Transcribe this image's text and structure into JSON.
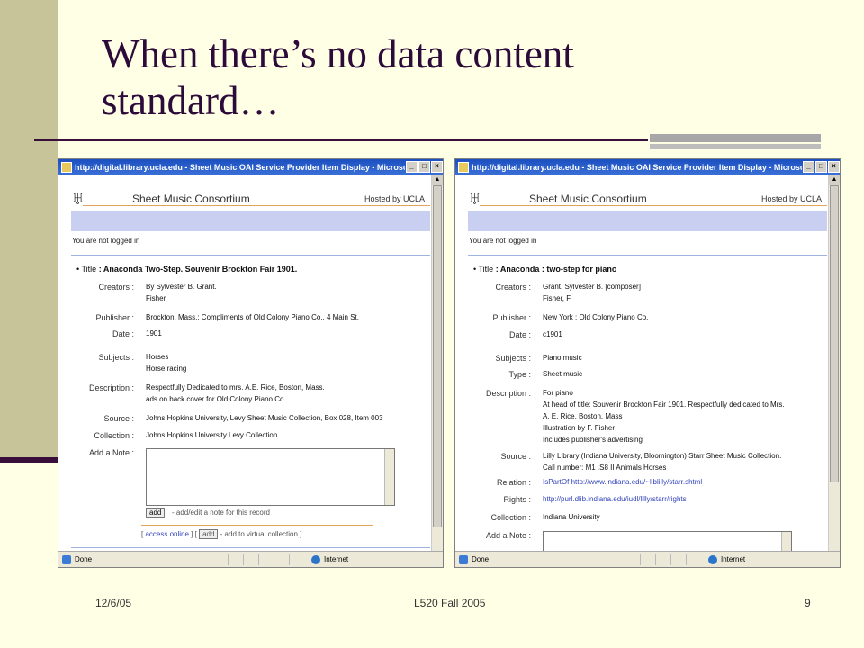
{
  "slide": {
    "title_line1": "When there’s no data content",
    "title_line2": "standard…",
    "footer_date": "12/6/05",
    "footer_course": "L520 Fall 2005",
    "footer_page": "9"
  },
  "colors": {
    "title": "#2c0a3a",
    "sidebar": "#c8c49a",
    "background": "#ffffe5",
    "link": "#3344bb"
  },
  "windows": [
    {
      "titlebar": "http://digital.library.ucla.edu - Sheet Music OAI Service Provider Item Display - Microsoft ...",
      "site_name": "Sheet Music Consortium",
      "hosted_by": "Hosted by UCLA",
      "login_status": "You are not logged in",
      "title_label": "Title",
      "title_value": ": Anaconda Two-Step. Souvenir Brockton Fair 1901.",
      "fields": [
        {
          "label": "Creators :",
          "values": [
            "By Sylvester B. Grant.",
            "Fisher"
          ]
        },
        {
          "label": "Publisher :",
          "values": [
            "Brockton, Mass.: Compliments of Old Colony Piano Co., 4 Main St."
          ]
        },
        {
          "label": "Date :",
          "values": [
            "1901"
          ]
        },
        {
          "label": "Subjects :",
          "values": [
            "Horses",
            "Horse racing"
          ]
        },
        {
          "label": "Description :",
          "values": [
            "Respectfully Dedicated to mrs. A.E. Rice, Boston, Mass.",
            "ads on back cover for Old Colony Piano Co."
          ]
        },
        {
          "label": "Source :",
          "values": [
            "Johns Hopkins University, Levy Sheet Music Collection, Box 028, Item 003"
          ]
        },
        {
          "label": "Collection :",
          "values": [
            "Johns Hopkins University Levy Collection"
          ]
        },
        {
          "label": "Add a Note :",
          "values": []
        }
      ],
      "add_button": "add",
      "add_note_hint": "- add/edit a note for this record",
      "access_online": "access online",
      "add_virtual_hint": "- add to virtual collection",
      "status_done": "Done",
      "status_zone": "Internet"
    },
    {
      "titlebar": "http://digital.library.ucla.edu - Sheet Music OAI Service Provider Item Display - Microsoft ...",
      "site_name": "Sheet Music Consortium",
      "hosted_by": "Hosted by UCLA",
      "login_status": "You are not logged in",
      "title_label": "Title",
      "title_value": ": Anaconda : two-step for piano",
      "fields": [
        {
          "label": "Creators :",
          "values": [
            "Grant, Sylvester B. [composer]",
            "Fisher, F."
          ]
        },
        {
          "label": "Publisher :",
          "values": [
            "New York : Old Colony Piano Co."
          ]
        },
        {
          "label": "Date :",
          "values": [
            "c1901"
          ]
        },
        {
          "label": "Subjects :",
          "values": [
            "Piano music"
          ]
        },
        {
          "label": "Type :",
          "values": [
            "Sheet music"
          ]
        },
        {
          "label": "Description :",
          "values": [
            "For piano",
            "At head of title: Souvenir Brockton Fair 1901. Respectfully dedicated to Mrs.",
            "A. E. Rice, Boston, Mass",
            "Illustration by F. Fisher",
            "Includes publisher's advertising"
          ]
        },
        {
          "label": "Source :",
          "values": [
            "Lilly Library (Indiana University, Bloomington) Starr Sheet Music Collection.",
            "Call number: M1 .S8 II Animals Horses"
          ]
        },
        {
          "label": "Relation :",
          "values": [
            "IsPartOf http://www.indiana.edu/~liblilly/starr.shtml"
          ]
        },
        {
          "label": "Rights :",
          "values": [
            "http://purl.dlib.indiana.edu/iudl/lilly/starr/rights"
          ]
        },
        {
          "label": "Collection :",
          "values": [
            "Indiana University"
          ]
        },
        {
          "label": "Add a Note :",
          "values": []
        }
      ],
      "status_done": "Done",
      "status_zone": "Internet"
    }
  ]
}
